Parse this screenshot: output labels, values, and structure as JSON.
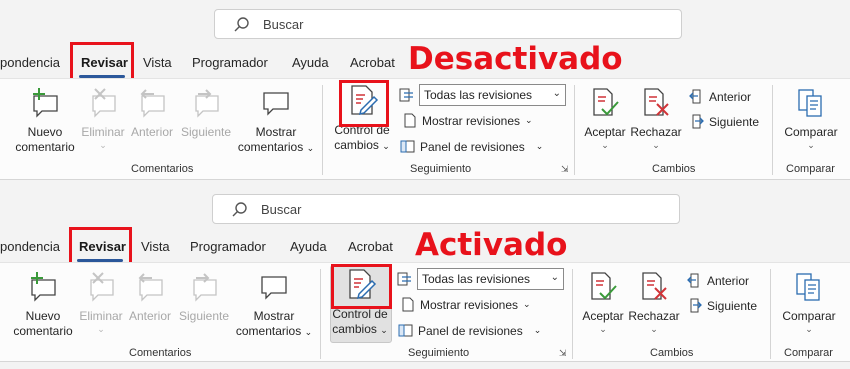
{
  "search": {
    "placeholder": "Buscar"
  },
  "tabs": [
    "pondencia",
    "Revisar",
    "Vista",
    "Programador",
    "Ayuda",
    "Acrobat"
  ],
  "labels": {
    "off": "Desactivado",
    "on": "Activado"
  },
  "comentarios": {
    "nuevo_line1": "Nuevo",
    "nuevo_line2": "comentario",
    "eliminar": "Eliminar",
    "anterior": "Anterior",
    "siguiente": "Siguiente",
    "mostrar_line1": "Mostrar",
    "mostrar_line2": "comentarios",
    "group": "Comentarios"
  },
  "seguimiento": {
    "control_line1": "Control de",
    "control_line2": "cambios",
    "select_value": "Todas las revisiones",
    "mostrar_revisiones": "Mostrar revisiones",
    "panel_revisiones": "Panel de revisiones",
    "group": "Seguimiento"
  },
  "cambios": {
    "aceptar": "Aceptar",
    "rechazar": "Rechazar",
    "anterior": "Anterior",
    "siguiente": "Siguiente",
    "group": "Cambios"
  },
  "comparar": {
    "button": "Comparar",
    "group": "Comparar"
  },
  "states": {
    "top": "Desactivado",
    "bottom": "Activado"
  },
  "colors": {
    "highlight": "#e8121b",
    "tab_underline": "#2b579a",
    "accept": "#3a9a3a",
    "reject": "#d13438",
    "icon_blue": "#2b6cb0"
  }
}
